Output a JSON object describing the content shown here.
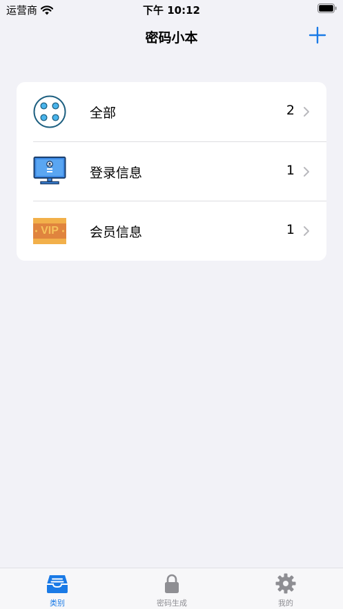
{
  "status_bar": {
    "carrier": "运营商",
    "time": "下午 10:12"
  },
  "nav": {
    "title": "密码小本"
  },
  "categories": [
    {
      "label": "全部",
      "count": "2",
      "icon": "all-categories-icon"
    },
    {
      "label": "登录信息",
      "count": "1",
      "icon": "computer-login-icon"
    },
    {
      "label": "会员信息",
      "count": "1",
      "icon": "vip-card-icon"
    }
  ],
  "vip_text": "VIP",
  "tabs": [
    {
      "label": "类别",
      "icon": "inbox-icon",
      "active": true
    },
    {
      "label": "密码生成",
      "icon": "lock-icon",
      "active": false
    },
    {
      "label": "我的",
      "icon": "gear-icon",
      "active": false
    }
  ],
  "colors": {
    "accent": "#1a7ae6",
    "inactive": "#8e8e93",
    "background": "#f2f2f7"
  }
}
